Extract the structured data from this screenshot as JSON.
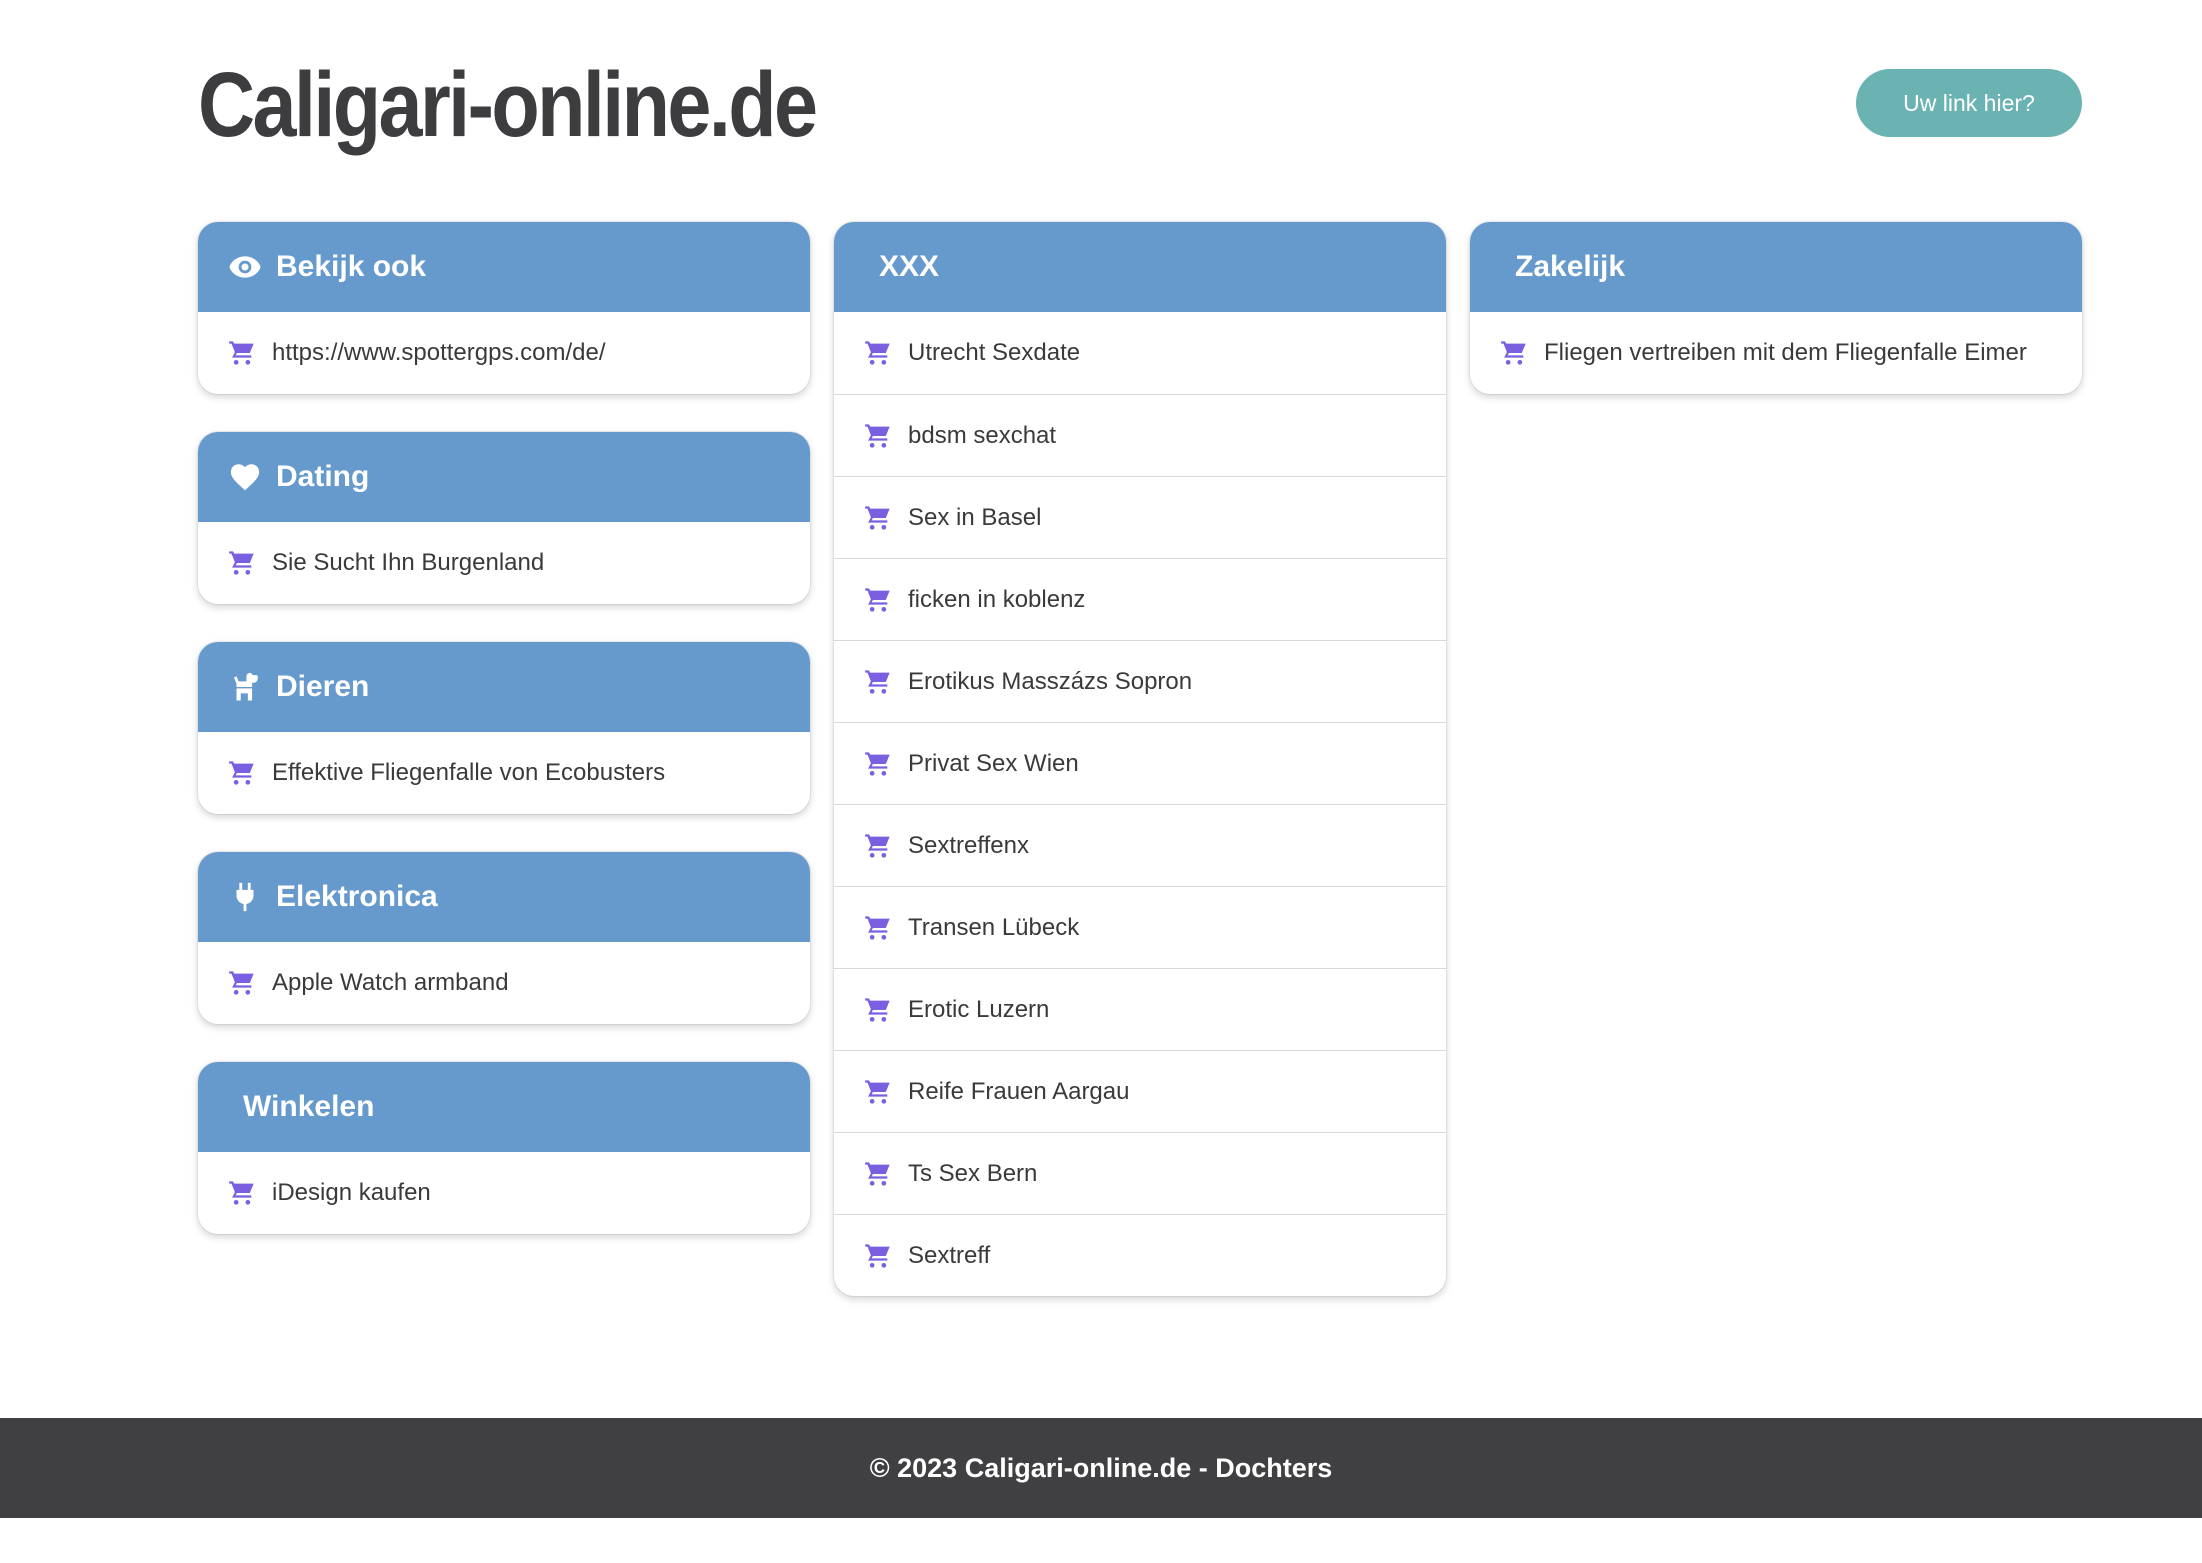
{
  "header": {
    "title": "Caligari-online.de",
    "cta_label": "Uw link hier?"
  },
  "colors": {
    "card_header": "#6699cc",
    "cta": "#6bb3b3",
    "cart_icon": "#7a5fe0",
    "footer_bg": "#404043"
  },
  "columns": [
    {
      "cards": [
        {
          "title": "Bekijk ook",
          "icon": "eye-icon",
          "links": [
            "https://www.spottergps.com/de/"
          ]
        },
        {
          "title": "Dating",
          "icon": "heart-icon",
          "links": [
            "Sie Sucht Ihn Burgenland"
          ]
        },
        {
          "title": "Dieren",
          "icon": "dog-icon",
          "links": [
            "Effektive Fliegenfalle von Ecobusters"
          ]
        },
        {
          "title": "Elektronica",
          "icon": "plug-icon",
          "links": [
            "Apple Watch armband"
          ]
        },
        {
          "title": "Winkelen",
          "icon": "",
          "links": [
            "iDesign kaufen"
          ]
        }
      ]
    },
    {
      "cards": [
        {
          "title": "XXX",
          "icon": "",
          "links": [
            "Utrecht Sexdate",
            "bdsm sexchat",
            "Sex in Basel",
            "ficken in koblenz",
            "Erotikus Masszázs Sopron",
            "Privat Sex Wien",
            "Sextreffenx",
            "Transen Lübeck",
            "Erotic Luzern",
            "Reife Frauen Aargau",
            "Ts Sex Bern",
            "Sextreff"
          ]
        }
      ]
    },
    {
      "cards": [
        {
          "title": "Zakelijk",
          "icon": "",
          "links": [
            "Fliegen vertreiben mit dem Fliegenfalle Eimer"
          ]
        }
      ]
    }
  ],
  "footer": {
    "text": "© 2023 Caligari-online.de - Dochters"
  }
}
